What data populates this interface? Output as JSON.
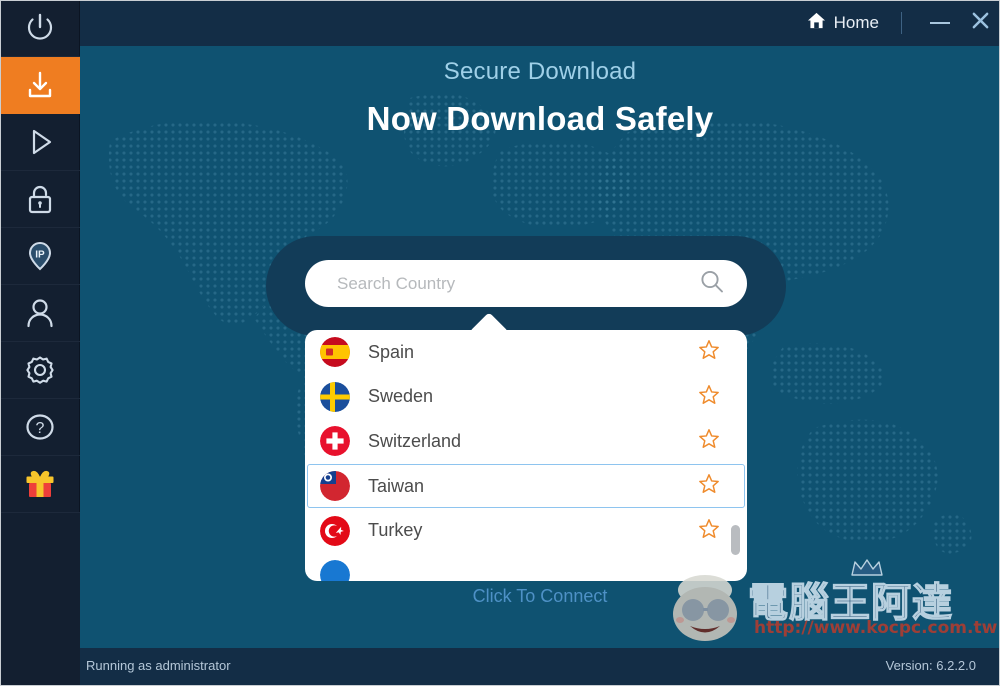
{
  "window": {
    "titlebar": {
      "home_label": "Home",
      "home_icon": "home-icon",
      "minimize_icon": "minimize-icon",
      "close_icon": "close-icon"
    }
  },
  "sidebar": {
    "items": [
      {
        "id": "power",
        "icon": "power-icon",
        "active": false
      },
      {
        "id": "download",
        "icon": "download-icon",
        "active": true
      },
      {
        "id": "play",
        "icon": "play-icon",
        "active": false
      },
      {
        "id": "lock",
        "icon": "lock-icon",
        "active": false
      },
      {
        "id": "ip",
        "icon": "ip-pin-icon",
        "active": false
      },
      {
        "id": "account",
        "icon": "user-icon",
        "active": false
      },
      {
        "id": "settings",
        "icon": "gear-icon",
        "active": false
      },
      {
        "id": "help",
        "icon": "question-icon",
        "active": false
      },
      {
        "id": "gift",
        "icon": "gift-icon",
        "active": false
      }
    ]
  },
  "main": {
    "subtitle": "Secure Download",
    "title": "Now Download Safely",
    "connect_label": "Click To Connect",
    "search": {
      "placeholder": "Search Country",
      "value": "",
      "icon": "search-icon"
    },
    "country_list": {
      "selected": "Taiwan",
      "items": [
        {
          "name": "Spain",
          "flag": "flag-es",
          "favorite": false,
          "star_icon": "star-outline-icon"
        },
        {
          "name": "Sweden",
          "flag": "flag-se",
          "favorite": false,
          "star_icon": "star-outline-icon"
        },
        {
          "name": "Switzerland",
          "flag": "flag-ch",
          "favorite": false,
          "star_icon": "star-outline-icon"
        },
        {
          "name": "Taiwan",
          "flag": "flag-tw",
          "favorite": false,
          "star_icon": "star-outline-icon"
        },
        {
          "name": "Turkey",
          "flag": "flag-tr",
          "favorite": false,
          "star_icon": "star-outline-icon"
        }
      ]
    }
  },
  "watermark": {
    "brand": "電腦王阿達",
    "url": "http://www.kocpc.com.tw"
  },
  "statusbar": {
    "left_text": "Running as administrator",
    "right_text": "Version: 6.2.2.0"
  },
  "colors": {
    "accent_orange": "#ef7d21",
    "sidebar_bg": "#131f30",
    "titlebar_bg": "#132d46",
    "main_bg": "#0f5271",
    "panel_bg": "#123c58",
    "selected_border": "#8ec4ef",
    "star_outline": "#ef8b2c",
    "link_blue": "#4e91c6"
  }
}
